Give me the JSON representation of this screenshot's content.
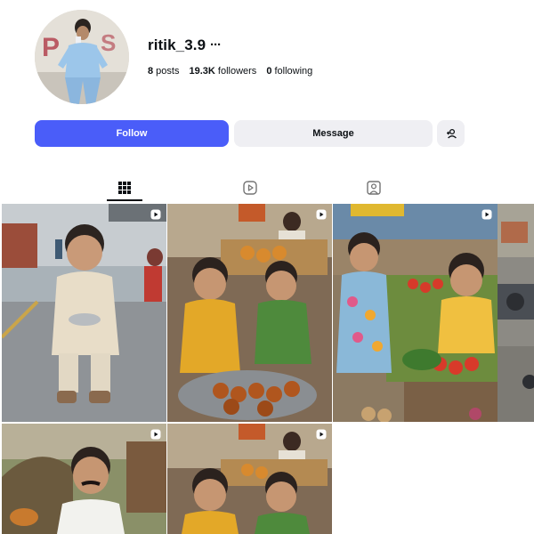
{
  "profile": {
    "username": "ritik_3.9",
    "more_label": "···",
    "posts_count": "8",
    "posts_label": " posts",
    "followers_count": "19.3K",
    "followers_label": " followers",
    "following_count": "0",
    "following_label": " following"
  },
  "actions": {
    "follow_label": "Follow",
    "message_label": "Message",
    "add_person_icon": "add-person-icon"
  },
  "tabs": [
    {
      "name": "posts",
      "icon": "grid-icon",
      "active": true
    },
    {
      "name": "reels",
      "icon": "reels-icon",
      "active": false
    },
    {
      "name": "tagged",
      "icon": "tagged-icon",
      "active": false
    }
  ],
  "colors": {
    "follow_button": "#4a5df9",
    "secondary_button": "#efeff3",
    "text": "#0c1014"
  },
  "posts": [
    {
      "type": "reel",
      "icon": "reel-icon"
    },
    {
      "type": "reel",
      "icon": "reel-icon"
    },
    {
      "type": "reel",
      "icon": "reel-icon"
    },
    {
      "type": "reel",
      "icon": "reel-icon"
    },
    {
      "type": "reel",
      "icon": "reel-icon"
    },
    {
      "type": "reel",
      "icon": "reel-icon"
    }
  ]
}
